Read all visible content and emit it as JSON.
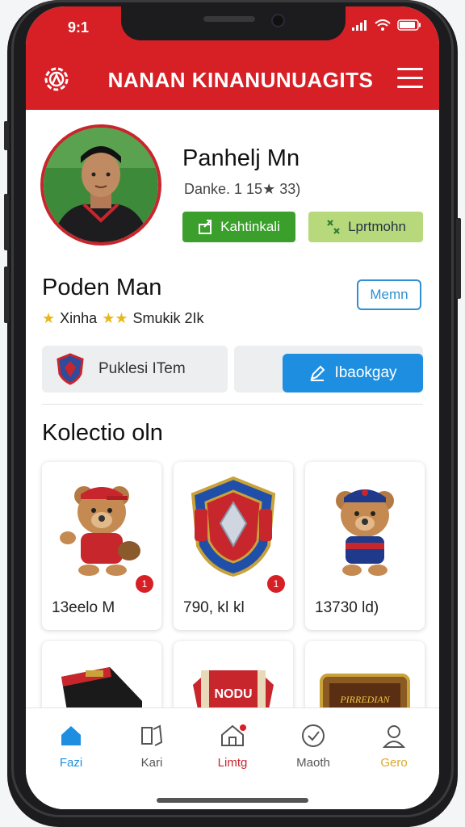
{
  "status": {
    "time": "9:1"
  },
  "header": {
    "title": "NANAN KINANUNUAGITS"
  },
  "profile": {
    "name": "Panhelj Mn",
    "subtitle": "Danke. 1 15★ 33)",
    "primary_button": "Kahtinkali",
    "secondary_button": "Lprtmohn"
  },
  "section": {
    "name": "Poden Man",
    "rating_text_1": "Xinha",
    "rating_text_2": "Smukik 2Ik",
    "follow_button": "Memn"
  },
  "item": {
    "label": "Puklesi ITem",
    "action_button": "Ibaokgay"
  },
  "collection": {
    "title": "Kolectio oln",
    "cards": [
      {
        "price": "13eelo M",
        "badge": "1"
      },
      {
        "price": "790, kǀ kl",
        "badge": "1"
      },
      {
        "price": "13730 ld)",
        "badge": ""
      },
      {
        "price": "",
        "badge": ""
      },
      {
        "price": "",
        "badge": ""
      },
      {
        "price": "",
        "badge": ""
      }
    ],
    "card_text": [
      "NODU",
      "PIRREDIAN"
    ]
  },
  "bottom_nav": [
    {
      "label": "Fazi",
      "active": true
    },
    {
      "label": "Kari",
      "active": false
    },
    {
      "label": "Limtg",
      "active": false
    },
    {
      "label": "Maoth",
      "active": false
    },
    {
      "label": "Gero",
      "active": false
    }
  ],
  "colors": {
    "brand_red": "#d71f26",
    "green": "#3aa02b",
    "light_green": "#b7d97c",
    "blue": "#1e8fe0",
    "active_nav": "#1e8fe0"
  }
}
